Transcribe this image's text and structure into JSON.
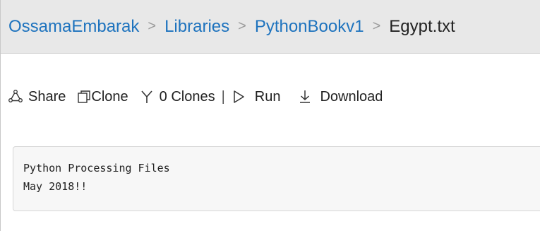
{
  "breadcrumb": {
    "items": [
      "OssamaEmbarak",
      "Libraries",
      "PythonBookv1"
    ],
    "separator": ">",
    "current": "Egypt.txt"
  },
  "toolbar": {
    "share_label": "Share",
    "clone_label": "Clone",
    "clones_count_label": "0 Clones",
    "divider": "|",
    "run_label": "Run",
    "download_label": "Download",
    "icons": [
      "share-icon",
      "clone-icon",
      "fork-icon",
      "play-icon",
      "download-icon"
    ]
  },
  "file": {
    "lines": [
      "Python Processing Files",
      "May 2018!!"
    ]
  },
  "colors": {
    "link": "#1e73be",
    "header_bg": "#e8e8e8",
    "content_bg": "#f7f7f7"
  }
}
